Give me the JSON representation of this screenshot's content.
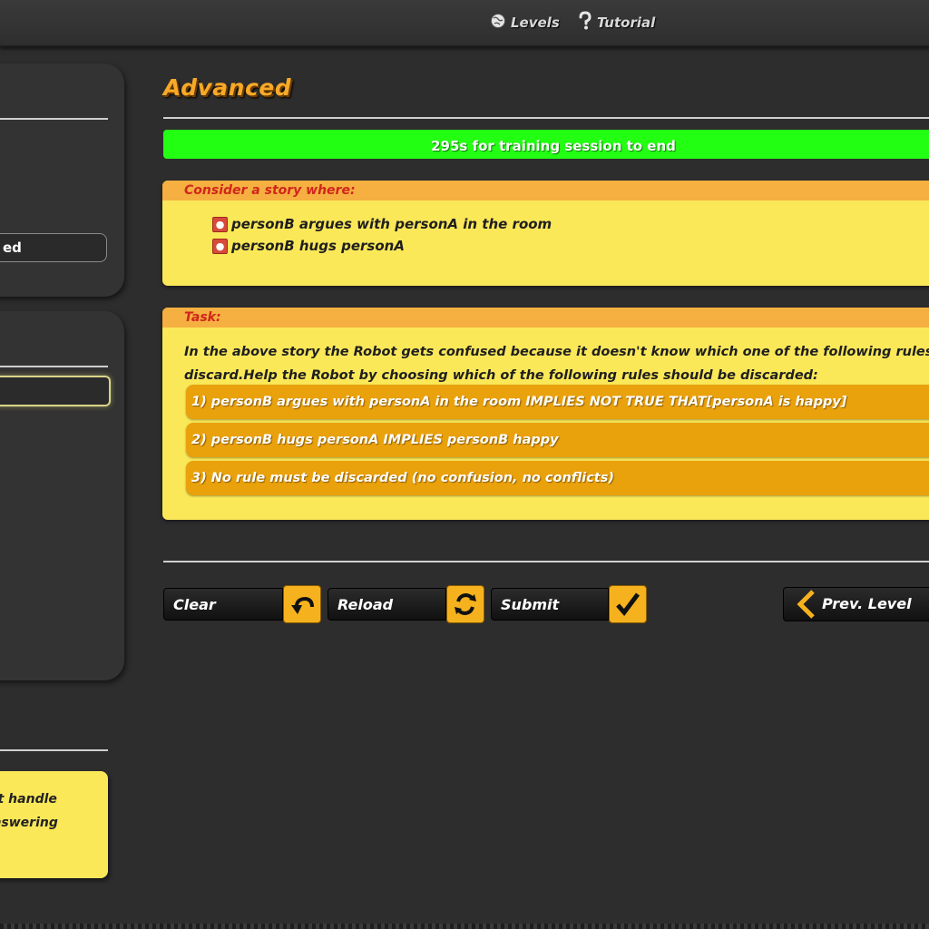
{
  "nav": {
    "levels_label": "Levels",
    "tutorial_label": "Tutorial"
  },
  "sidebar": {
    "selected_fragment": "ed",
    "note_lines": [
      "ot handle",
      "answering"
    ]
  },
  "main": {
    "title": "Advanced",
    "timer_text": "295s for training session to end",
    "timer_progress": 1.0,
    "story": {
      "header": "Consider a story where:",
      "items": [
        "personB argues with personA in the room",
        "personB hugs personA"
      ]
    },
    "task": {
      "header": "Task:",
      "line1": "In the above story the Robot gets confused because it doesn't know which one of the following rules",
      "line2": "discard.Help the Robot by choosing which of the following rules should be discarded:",
      "options": [
        "1) personB argues with personA in the room IMPLIES NOT TRUE THAT[personA is happy]",
        "2) personB hugs personA IMPLIES personB happy",
        "3) No rule must be discarded (no confusion, no conflicts)"
      ]
    }
  },
  "controls": {
    "clear_label": "Clear",
    "reload_label": "Reload",
    "submit_label": "Submit",
    "prev_level_label": "Prev. Level"
  },
  "colors": {
    "accent": "#f6b21e",
    "progress": "#23ff12",
    "panel_yellow": "#fbe859",
    "header_orange": "#f5b041",
    "option_orange": "#e9a10c",
    "header_red": "#d0261b"
  }
}
